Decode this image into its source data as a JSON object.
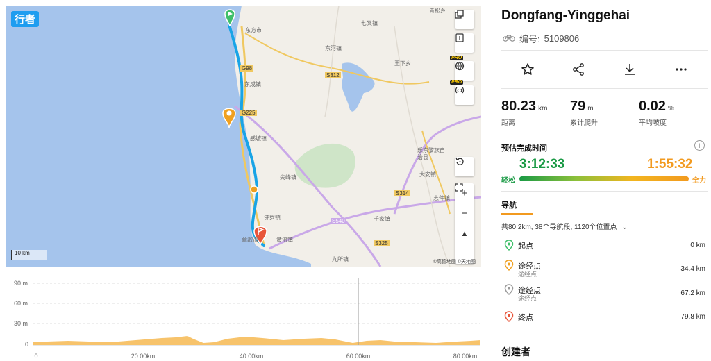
{
  "map": {
    "logo": "行者",
    "scale_label": "10 km",
    "attribution": "©高德地图 ©天地图",
    "place_labels": [
      "东方市",
      "七叉镇",
      "东河镇",
      "王下乡",
      "东成镇",
      "感城镇",
      "尖峰镇",
      "佛罗镇",
      "黄流镇",
      "乐东黎族自治县",
      "大安镇",
      "志仲镇",
      "千家镇",
      "九所镇",
      "莺歌海",
      "青松乡"
    ],
    "road_labels": [
      "G98",
      "S312",
      "G225",
      "S540",
      "S314",
      "S325"
    ],
    "pro_badge": "PRO",
    "controls": {
      "layers_icon": "layers-icon",
      "book_icon": "book-icon",
      "globe_icon": "globe-icon",
      "signal_icon": "signal-icon",
      "reset_icon": "reset-icon",
      "zoom_in": "+",
      "zoom_out": "−",
      "compass": "▲",
      "fullscreen_icon": "fullscreen-icon"
    }
  },
  "elevation": {
    "y_labels": [
      "90 m",
      "60 m",
      "30 m",
      "0"
    ],
    "x_labels": [
      "0",
      "20.00km",
      "40.00km",
      "60.00km",
      "80.00km"
    ],
    "fill_color": "#f7c36b"
  },
  "route": {
    "title": "Dongfang-Yinggehai",
    "id_label": "编号:",
    "id_value": "5109806",
    "actions": {
      "favorite_icon": "star-icon",
      "share_icon": "share-icon",
      "download_icon": "download-icon",
      "more_icon": "more-icon"
    },
    "stats": [
      {
        "value": "80.23",
        "unit": "km",
        "label": "距离"
      },
      {
        "value": "79",
        "unit": "m",
        "label": "累计爬升"
      },
      {
        "value": "0.02",
        "unit": "%",
        "label": "平均坡度"
      }
    ],
    "estimate": {
      "title": "预估完成时间",
      "easy_time": "3:12:33",
      "full_time": "1:55:32",
      "easy_label": "轻松",
      "full_label": "全力",
      "easy_color": "#1a9a45",
      "full_color": "#f29a1f"
    },
    "nav": {
      "title": "导航",
      "summary": "共80.2km, 38个导航段, 1120个位置点",
      "waypoints": [
        {
          "name": "起点",
          "sub": "",
          "distance": "0 km",
          "color": "#3fbf6a"
        },
        {
          "name": "途经点",
          "sub": "途经点",
          "distance": "34.4 km",
          "color": "#f0a020"
        },
        {
          "name": "途经点",
          "sub": "途经点",
          "distance": "67.2 km",
          "color": "#999999"
        },
        {
          "name": "终点",
          "sub": "",
          "distance": "79.8 km",
          "color": "#e8553a"
        }
      ]
    },
    "creator_title": "创建者"
  }
}
